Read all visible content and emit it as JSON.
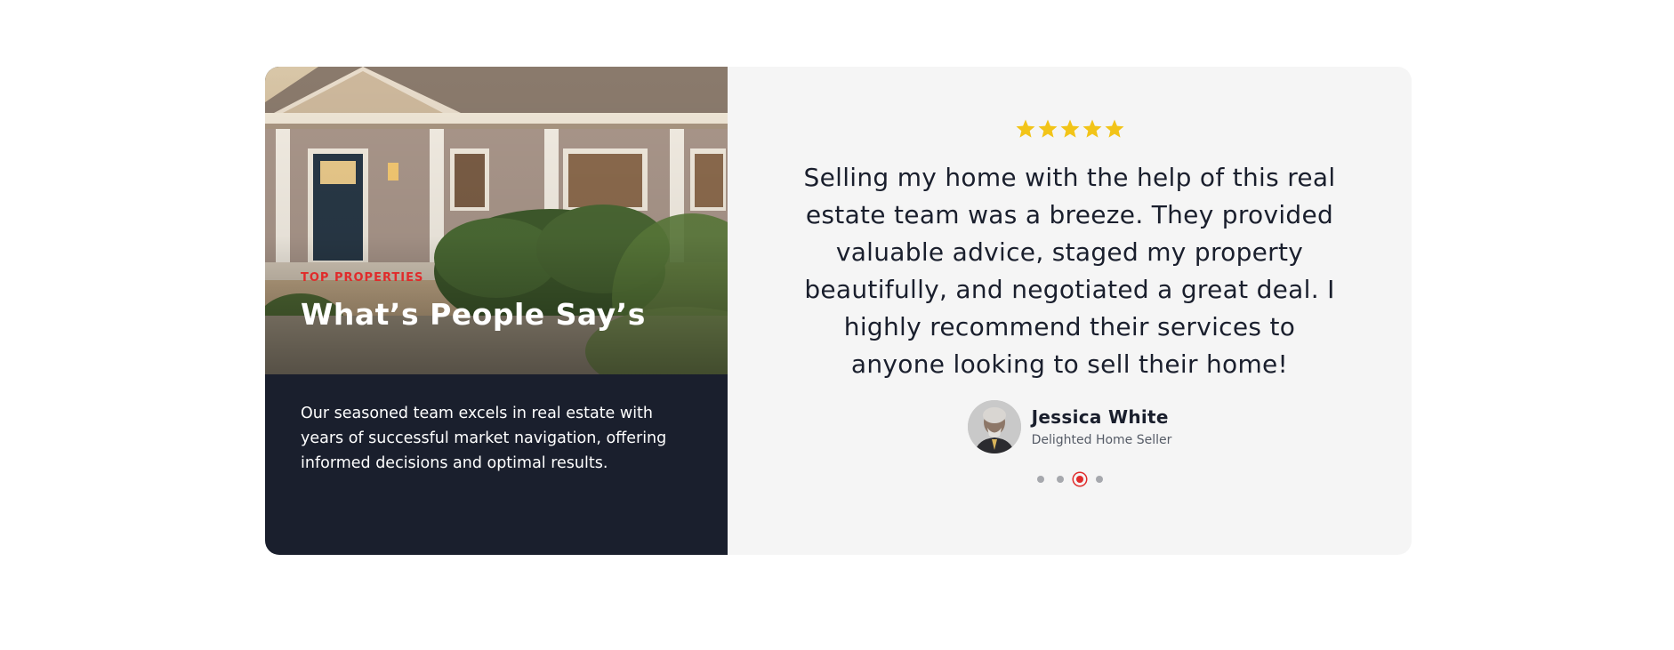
{
  "section": {
    "eyebrow": "Top Properties",
    "heading": "What’s People Say’s",
    "blurb": "Our seasoned team excels in real estate with years of successful market navigation, offering informed decisions and optimal results."
  },
  "testimonial": {
    "rating": 5,
    "star_color": "#f2c418",
    "quote": "Selling my home with the help of this real estate team was a breeze. They provided valuable advice, staged my property beautifully, and negotiated a great deal. I highly recommend their services to anyone looking to sell their home!",
    "author_name": "Jessica White",
    "author_role": "Delighted Home Seller"
  },
  "pagination": {
    "count": 4,
    "active_index": 2,
    "accent_color": "#e02b2b"
  },
  "colors": {
    "dark_panel": "#1a1f2d",
    "accent": "#e02b2b",
    "card_bg": "#f5f5f5"
  }
}
